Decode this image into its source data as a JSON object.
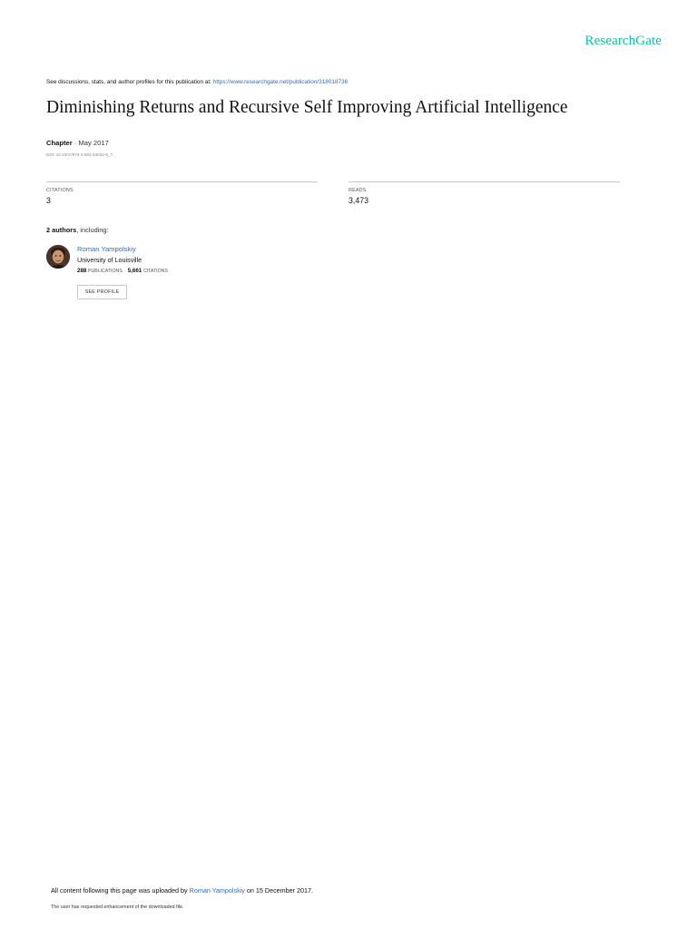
{
  "brand": {
    "name": "ResearchGate",
    "color": "#00c8a8"
  },
  "discussions": {
    "text": "See discussions, stats, and author profiles for this publication at: ",
    "link": "https://www.researchgate.net/publication/318018736"
  },
  "publication": {
    "title": "Diminishing Returns and Recursive Self Improving Artificial Intelligence",
    "type": "Chapter",
    "separator": " · ",
    "date": "May 2017",
    "doi": "DOI: 10.1007/978-3-662-54033-6_7"
  },
  "stats": {
    "citations_label": "CITATIONS",
    "citations_value": "3",
    "reads_label": "READS",
    "reads_value": "3,473"
  },
  "authors": {
    "count_text": "2 authors",
    "suffix": ", including:",
    "items": [
      {
        "name": "Roman Yampolskiy",
        "institution": "University of Louisville",
        "publications_count": "288",
        "publications_label": "PUBLICATIONS",
        "citations_count": "5,661",
        "citations_label": "CITATIONS",
        "button_label": "SEE PROFILE"
      }
    ]
  },
  "footer": {
    "uploaded_prefix": "All content following this page was uploaded by ",
    "uploader": "Roman Yampolskiy",
    "uploaded_suffix": " on 15 December 2017.",
    "request_note": "The user has requested enhancement of the downloaded file."
  },
  "colors": {
    "link": "#2f6fb8",
    "divider": "#c8c8c8"
  }
}
